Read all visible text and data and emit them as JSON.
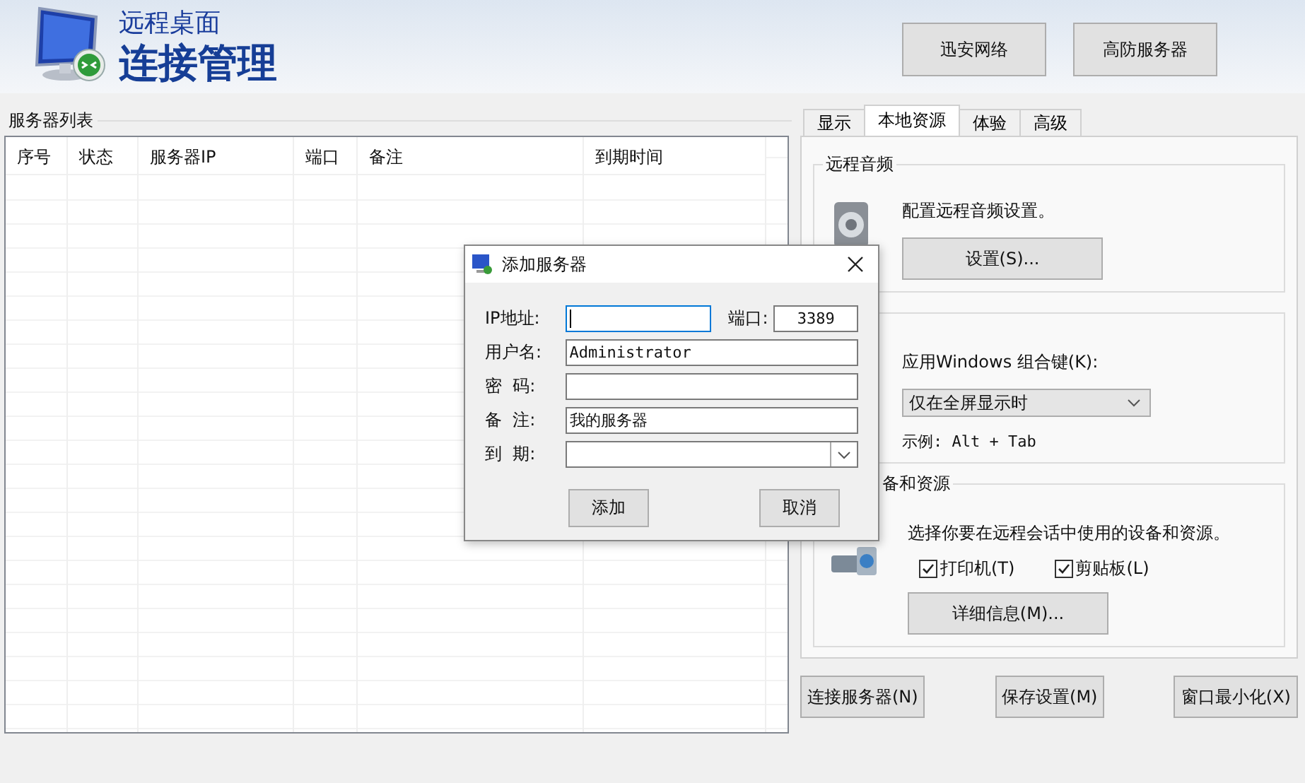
{
  "header": {
    "title_small": "远程桌面",
    "title_large": "连接管理",
    "buttons": [
      "迅安网络",
      "高防服务器"
    ]
  },
  "server_list": {
    "label": "服务器列表",
    "columns": [
      "序号",
      "状态",
      "服务器IP",
      "端口",
      "备注",
      "到期时间"
    ]
  },
  "tabs": [
    {
      "label": "显示",
      "selected": false
    },
    {
      "label": "本地资源",
      "selected": true
    },
    {
      "label": "体验",
      "selected": false
    },
    {
      "label": "高级",
      "selected": false
    }
  ],
  "audio": {
    "label": "远程音频",
    "text": "配置远程音频设置。",
    "button": "设置(S)..."
  },
  "keyboard": {
    "text": "应用Windows 组合键(K):",
    "value": "仅在全屏显示时",
    "example": "示例: Alt + Tab"
  },
  "devices": {
    "label": "备和资源",
    "text": "选择你要在远程会话中使用的设备和资源。",
    "checkboxes": [
      {
        "label": "打印机(T)",
        "checked": true
      },
      {
        "label": "剪贴板(L)",
        "checked": true
      }
    ],
    "button": "详细信息(M)..."
  },
  "bottom_buttons": [
    "连接服务器(N)",
    "保存设置(M)",
    "窗口最小化(X)"
  ],
  "dialog": {
    "title": "添加服务器",
    "fields": [
      {
        "kind": "ip",
        "label": "IP地址:",
        "focused": true,
        "port_label": "端口:",
        "port_value": "3389"
      },
      {
        "kind": "text",
        "label": "用户名:",
        "value": "Administrator",
        "focused": false
      },
      {
        "kind": "text",
        "label": "密  码:",
        "focused": false
      },
      {
        "kind": "text",
        "label": "备  注:",
        "value": "我的服务器",
        "focused": false
      },
      {
        "kind": "date",
        "label": "到  期:",
        "focused": false
      }
    ],
    "buttons": [
      "添加",
      "取消"
    ]
  }
}
